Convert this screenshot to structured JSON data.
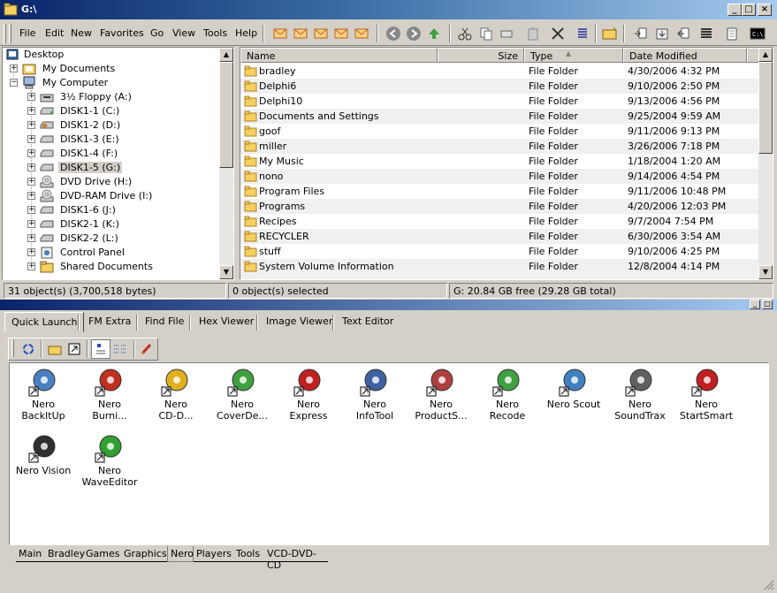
{
  "window": {
    "title": "G:\\"
  },
  "menu": {
    "file": "File",
    "edit": "Edit",
    "new": "New",
    "favorites": "Favorites",
    "go": "Go",
    "view": "View",
    "tools": "Tools",
    "help": "Help"
  },
  "tree": {
    "items": [
      {
        "label": "Desktop"
      },
      {
        "label": "My Documents"
      },
      {
        "label": "My Computer"
      },
      {
        "label": "3½ Floppy (A:)"
      },
      {
        "label": "DISK1-1 (C:)"
      },
      {
        "label": "DISK1-2 (D:)"
      },
      {
        "label": "DISK1-3 (E:)"
      },
      {
        "label": "DISK1-4 (F:)"
      },
      {
        "label": "DISK1-5 (G:)"
      },
      {
        "label": "DVD Drive (H:)"
      },
      {
        "label": "DVD-RAM Drive (I:)"
      },
      {
        "label": "DISK1-6 (J:)"
      },
      {
        "label": "DISK2-1 (K:)"
      },
      {
        "label": "DISK2-2 (L:)"
      },
      {
        "label": "Control Panel"
      },
      {
        "label": "Shared Documents"
      }
    ]
  },
  "files": {
    "columns": {
      "name": "Name",
      "size": "Size",
      "type": "Type",
      "date": "Date Modified"
    },
    "rows": [
      {
        "name": "bradley",
        "type": "File Folder",
        "date": "4/30/2006 4:32 PM"
      },
      {
        "name": "Delphi6",
        "type": "File Folder",
        "date": "9/10/2006 2:50 PM"
      },
      {
        "name": "Delphi10",
        "type": "File Folder",
        "date": "9/13/2006 4:56 PM"
      },
      {
        "name": "Documents and Settings",
        "type": "File Folder",
        "date": "9/25/2004 9:59 AM"
      },
      {
        "name": "goof",
        "type": "File Folder",
        "date": "9/11/2006 9:13 PM"
      },
      {
        "name": "miller",
        "type": "File Folder",
        "date": "3/26/2006 7:18 PM"
      },
      {
        "name": "My Music",
        "type": "File Folder",
        "date": "1/18/2004 1:20 AM"
      },
      {
        "name": "nono",
        "type": "File Folder",
        "date": "9/14/2006 4:54 PM"
      },
      {
        "name": "Program Files",
        "type": "File Folder",
        "date": "9/11/2006 10:48 PM"
      },
      {
        "name": "Programs",
        "type": "File Folder",
        "date": "4/20/2006 12:03 PM"
      },
      {
        "name": "Recipes",
        "type": "File Folder",
        "date": "9/7/2004 7:54 PM"
      },
      {
        "name": "RECYCLER",
        "type": "File Folder",
        "date": "6/30/2006 3:54 AM"
      },
      {
        "name": "stuff",
        "type": "File Folder",
        "date": "9/10/2006 4:25 PM"
      },
      {
        "name": "System Volume Information",
        "type": "File Folder",
        "date": "12/8/2004 4:14 PM"
      }
    ]
  },
  "status": {
    "objects": "31 object(s) (3,700,518 bytes)",
    "selected": "0 object(s) selected",
    "free": "G: 20.84 GB free (29.28 GB total)"
  },
  "toptabs": [
    "Quick Launch",
    "FM Extra",
    "Find File",
    "Hex Viewer",
    "Image Viewer",
    "Text Editor"
  ],
  "launch": {
    "items": [
      {
        "line1": "Nero",
        "line2": "BackItUp",
        "icon": "nero-backitup-icon"
      },
      {
        "line1": "Nero",
        "line2": "Burni...",
        "icon": "nero-burning-icon"
      },
      {
        "line1": "Nero",
        "line2": "CD-D...",
        "icon": "nero-cd-dvd-icon"
      },
      {
        "line1": "Nero",
        "line2": "CoverDe...",
        "icon": "nero-coverdesigner-icon"
      },
      {
        "line1": "Nero",
        "line2": "Express",
        "icon": "nero-express-icon"
      },
      {
        "line1": "Nero",
        "line2": "InfoTool",
        "icon": "nero-infotool-icon"
      },
      {
        "line1": "Nero",
        "line2": "ProductS...",
        "icon": "nero-productsuite-icon"
      },
      {
        "line1": "Nero",
        "line2": "Recode",
        "icon": "nero-recode-icon"
      },
      {
        "line1": "Nero Scout",
        "line2": "",
        "icon": "nero-scout-icon"
      },
      {
        "line1": "Nero",
        "line2": "SoundTrax",
        "icon": "nero-soundtrax-icon"
      },
      {
        "line1": "Nero",
        "line2": "StartSmart",
        "icon": "nero-startsmart-icon"
      },
      {
        "line1": "Nero Vision",
        "line2": "",
        "icon": "nero-vision-icon"
      },
      {
        "line1": "Nero",
        "line2": "WaveEditor",
        "icon": "nero-waveeditor-icon"
      }
    ]
  },
  "bottomtabs": [
    "Main",
    "Bradley",
    "Games",
    "Graphics",
    "Nero",
    "Players",
    "Tools",
    "VCD-DVD-CD"
  ]
}
